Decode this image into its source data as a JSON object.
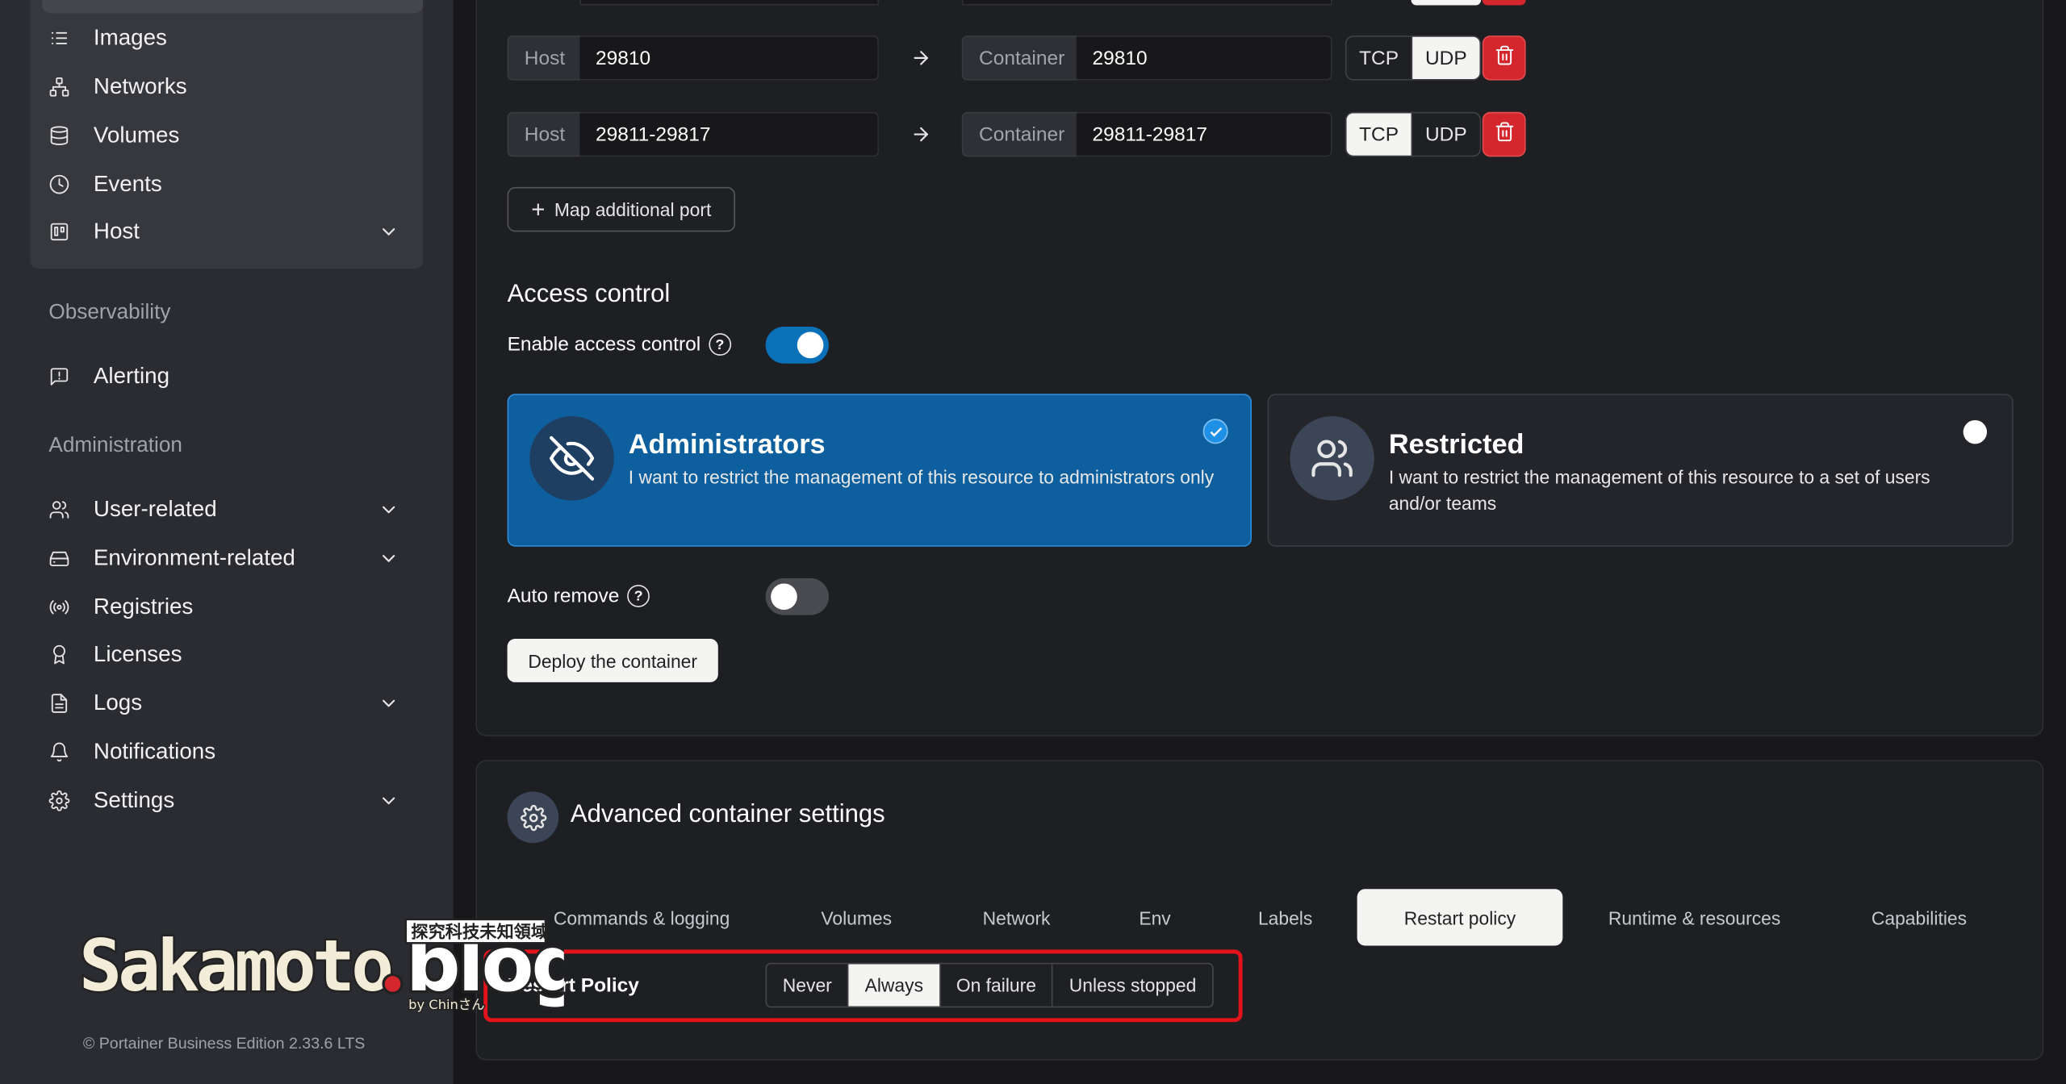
{
  "sidebar": {
    "items": [
      {
        "label": "Images",
        "icon": "list-icon"
      },
      {
        "label": "Networks",
        "icon": "network-icon"
      },
      {
        "label": "Volumes",
        "icon": "database-icon"
      },
      {
        "label": "Events",
        "icon": "clock-icon"
      },
      {
        "label": "Host",
        "icon": "server-icon"
      }
    ],
    "observability_heading": "Observability",
    "alerting": "Alerting",
    "administration_heading": "Administration",
    "admin_items": [
      {
        "label": "User-related",
        "icon": "users-icon"
      },
      {
        "label": "Environment-related",
        "icon": "drive-icon"
      },
      {
        "label": "Registries",
        "icon": "radio-icon"
      },
      {
        "label": "Licenses",
        "icon": "award-icon"
      },
      {
        "label": "Logs",
        "icon": "file-text-icon"
      },
      {
        "label": "Notifications",
        "icon": "bell-icon"
      },
      {
        "label": "Settings",
        "icon": "gear-icon"
      }
    ],
    "footer": "© Portainer Business Edition  2.33.6 LTS"
  },
  "watermark": {
    "text": "Sakamoto.blog",
    "tagline": "探究科技未知領域",
    "byline": "by Chinさん"
  },
  "ports": {
    "host_label": "Host",
    "container_label": "Container",
    "rows": [
      {
        "host": "29810",
        "container": "29810",
        "protocol": "UDP"
      },
      {
        "host": "29811-29817",
        "container": "29811-29817",
        "protocol": "TCP"
      }
    ],
    "tcp": "TCP",
    "udp": "UDP",
    "map_additional": "Map additional port"
  },
  "access": {
    "title": "Access control",
    "enable_label": "Enable access control",
    "enabled": true,
    "admin_title": "Administrators",
    "admin_desc": "I want to restrict the management of this resource to administrators only",
    "restricted_title": "Restricted",
    "restricted_desc": "I want to restrict the management of this resource to a set of users and/or teams",
    "selected": "Administrators"
  },
  "auto_remove": {
    "label": "Auto remove",
    "enabled": false
  },
  "deploy_label": "Deploy the container",
  "advanced": {
    "title": "Advanced container settings",
    "tabs": [
      "Commands & logging",
      "Volumes",
      "Network",
      "Env",
      "Labels",
      "Restart policy",
      "Runtime & resources",
      "Capabilities"
    ],
    "active_tab": "Restart policy",
    "restart_label": "Restart Policy",
    "restart_options": [
      "Never",
      "Always",
      "On failure",
      "Unless stopped"
    ],
    "restart_selected": "Always"
  },
  "colors": {
    "accent": "#0e5f9e",
    "danger": "#d3272d",
    "highlight": "#e3131b"
  }
}
